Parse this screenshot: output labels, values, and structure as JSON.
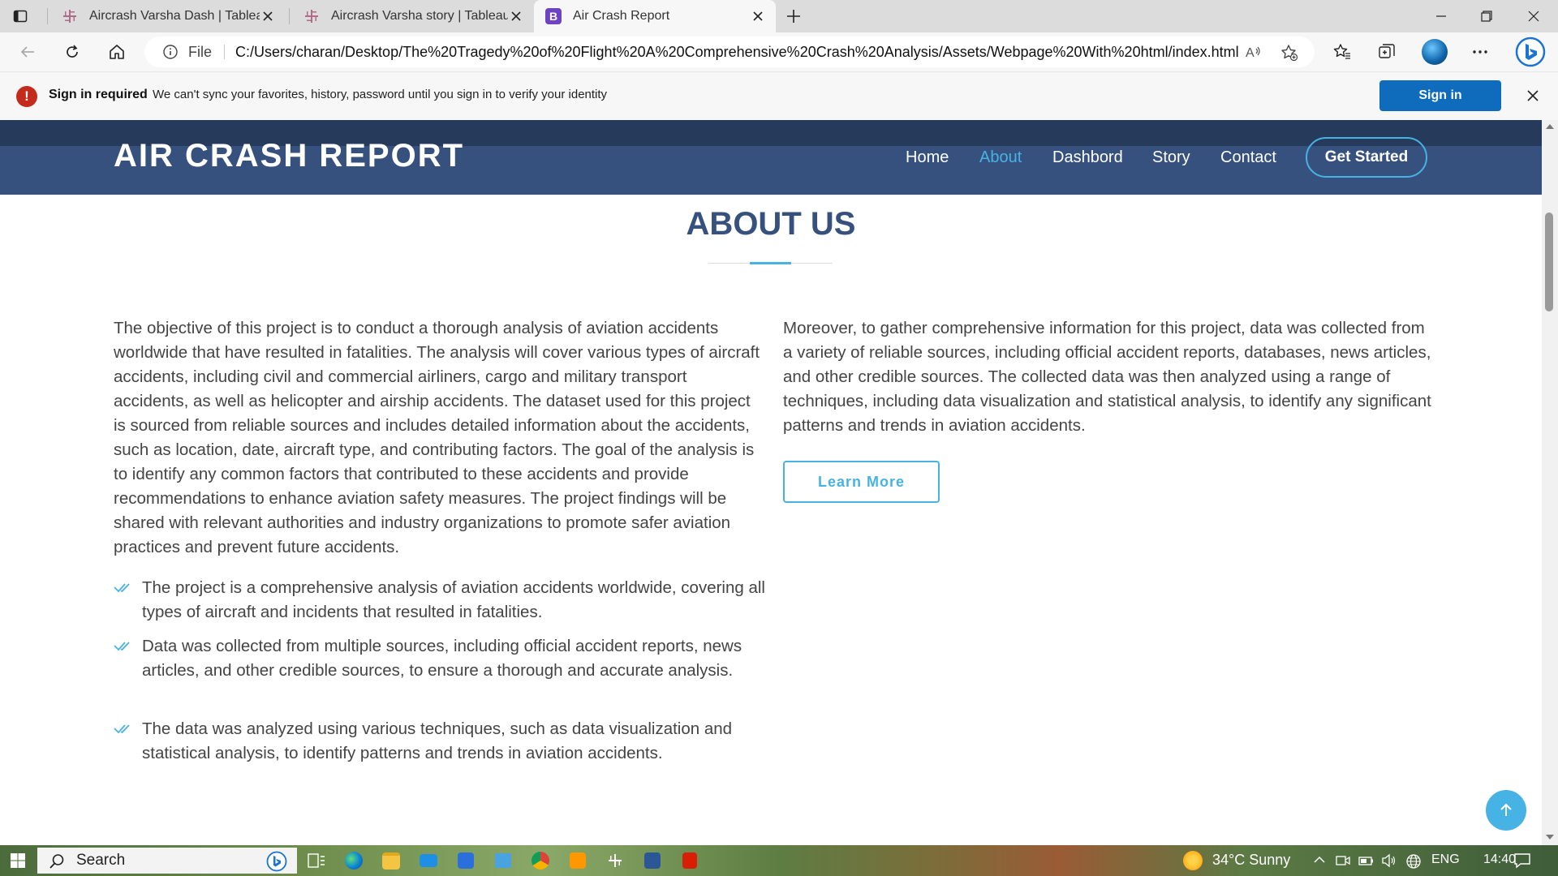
{
  "browser": {
    "tabs": [
      {
        "title": "Aircrash Varsha Dash | Tableau Pu",
        "icon": "tableau-icon",
        "active": false
      },
      {
        "title": "Aircrash Varsha story | Tableau Pu",
        "icon": "tableau-icon",
        "active": false
      },
      {
        "title": "Air Crash Report",
        "icon": "bootstrap-b-icon",
        "favicon_letter": "B",
        "active": true
      }
    ],
    "address": {
      "scheme_label": "File",
      "url": "C:/Users/charan/Desktop/The%20Tragedy%20of%20Flight%20A%20Comprehensive%20Crash%20Analysis/Assets/Webpage%20With%20html/index.html"
    },
    "infobar": {
      "title": "Sign in required",
      "message": "We can't sync your favorites, history, password until you sign in to verify your identity",
      "button": "Sign in",
      "icon_glyph": "!"
    }
  },
  "site": {
    "logo": "AIR CRASH REPORT",
    "nav": [
      {
        "label": "Home",
        "active": false
      },
      {
        "label": "About",
        "active": true
      },
      {
        "label": "Dashbord",
        "active": false
      },
      {
        "label": "Story",
        "active": false
      },
      {
        "label": "Contact",
        "active": false
      }
    ],
    "cta": "Get Started",
    "colors": {
      "header": "#37517e",
      "accent": "#47b2e4",
      "title": "#37517e"
    }
  },
  "about": {
    "title": "ABOUT US",
    "left_paragraph": "The objective of this project is to conduct a thorough analysis of aviation accidents worldwide that have resulted in fatalities. The analysis will cover various types of aircraft accidents, including civil and commercial airliners, cargo and military transport accidents, as well as helicopter and airship accidents. The dataset used for this project is sourced from reliable sources and includes detailed information about the accidents, such as location, date, aircraft type, and contributing factors. The goal of the analysis is to identify any common factors that contributed to these accidents and provide recommendations to enhance aviation safety measures. The project findings will be shared with relevant authorities and industry organizations to promote safer aviation practices and prevent future accidents.",
    "bullets": [
      "The project is a comprehensive analysis of aviation accidents worldwide, covering all types of aircraft and incidents that resulted in fatalities.",
      "Data was collected from multiple sources, including official accident reports, news articles, and other credible sources, to ensure a thorough and accurate analysis.",
      "The data was analyzed using various techniques, such as data visualization and statistical analysis, to identify patterns and trends in aviation accidents."
    ],
    "right_paragraph": "Moreover, to gather comprehensive information for this project, data was collected from a variety of reliable sources, including official accident reports, databases, news articles, and other credible sources. The collected data was then analyzed using a range of techniques, including data visualization and statistical analysis, to identify any significant patterns and trends in aviation accidents.",
    "learn_more": "Learn More"
  },
  "taskbar": {
    "search_label": "Search",
    "weather": "34°C  Sunny",
    "language": "ENG",
    "time": "14:40"
  }
}
